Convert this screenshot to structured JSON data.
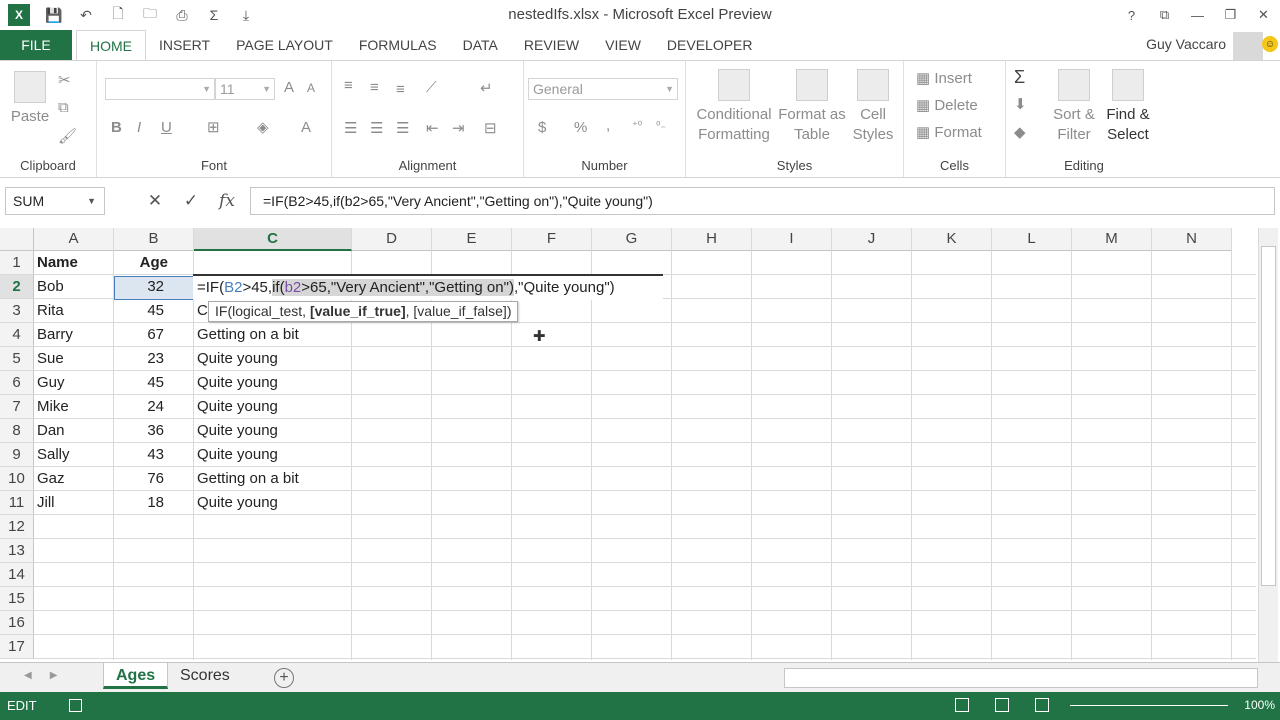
{
  "window": {
    "title": "nestedIfs.xlsx - Microsoft Excel Preview",
    "controls": [
      "?",
      "⧉",
      "—",
      "❐",
      "✕"
    ]
  },
  "qat": {
    "logo": "X",
    "icons": [
      "save-icon",
      "undo-icon",
      "new-icon",
      "open-icon",
      "print-preview-icon",
      "autosum-icon",
      "customize-icon"
    ]
  },
  "tabs": {
    "file": "FILE",
    "items": [
      "HOME",
      "INSERT",
      "PAGE LAYOUT",
      "FORMULAS",
      "DATA",
      "REVIEW",
      "VIEW",
      "DEVELOPER"
    ],
    "active": "HOME"
  },
  "user": {
    "name": "Guy Vaccaro"
  },
  "ribbon": {
    "clipboard": {
      "label": "Clipboard",
      "paste": "Paste"
    },
    "font": {
      "label": "Font",
      "size": "11",
      "bold": "B",
      "italic": "I",
      "underline": "U"
    },
    "alignment": {
      "label": "Alignment"
    },
    "number": {
      "label": "Number",
      "format": "General",
      "currency": "$",
      "percent": "%",
      "comma": ","
    },
    "styles": {
      "label": "Styles",
      "conditional_1": "Conditional",
      "conditional_2": "Formatting",
      "format_as_1": "Format as",
      "format_as_2": "Table",
      "cell_1": "Cell",
      "cell_2": "Styles"
    },
    "cells": {
      "label": "Cells",
      "insert": "Insert",
      "delete": "Delete",
      "format": "Format"
    },
    "editing": {
      "label": "Editing",
      "sort_1": "Sort &",
      "sort_2": "Filter",
      "find_1": "Find &",
      "find_2": "Select"
    }
  },
  "formula_bar": {
    "name_box": "SUM",
    "cancel": "✕",
    "enter": "✓",
    "fx": "fx",
    "formula": "=IF(B2>45,if(b2>65,\"Very Ancient\",\"Getting on\"),\"Quite young\")"
  },
  "columns": [
    "A",
    "B",
    "C",
    "D",
    "E",
    "F",
    "G",
    "H",
    "I",
    "J",
    "K",
    "L",
    "M",
    "N"
  ],
  "rows": [
    "1",
    "2",
    "3",
    "4",
    "5",
    "6",
    "7",
    "8",
    "9",
    "10",
    "11",
    "12",
    "13",
    "14",
    "15",
    "16",
    "17"
  ],
  "sheet": {
    "header": {
      "name": "Name",
      "age": "Age"
    },
    "data": [
      {
        "name": "Bob",
        "age": "32",
        "result": ""
      },
      {
        "name": "Rita",
        "age": "45",
        "result": "C"
      },
      {
        "name": "Barry",
        "age": "67",
        "result": "Getting on a bit"
      },
      {
        "name": "Sue",
        "age": "23",
        "result": "Quite young"
      },
      {
        "name": "Guy",
        "age": "45",
        "result": "Quite young"
      },
      {
        "name": "Mike",
        "age": "24",
        "result": "Quite young"
      },
      {
        "name": "Dan",
        "age": "36",
        "result": "Quite young"
      },
      {
        "name": "Sally",
        "age": "43",
        "result": "Quite young"
      },
      {
        "name": "Gaz",
        "age": "76",
        "result": "Getting on a bit"
      },
      {
        "name": "Jill",
        "age": "18",
        "result": "Quite young"
      }
    ]
  },
  "edit_cell": {
    "part1": "=IF(",
    "ref1": "B2",
    "part2": ">45,",
    "nested_if": "if(",
    "ref2": "b2",
    "nested_rest": ">65,\"Very Ancient\",\"Getting on\")",
    "part3": ",\"Quite young\")"
  },
  "tooltip": {
    "prefix": "IF(logical_test, ",
    "bold_arg": "[value_if_true]",
    "suffix": ", [value_if_false])"
  },
  "sheet_tabs": [
    "Ages",
    "Scores"
  ],
  "active_sheet": "Ages",
  "status": {
    "mode": "EDIT",
    "zoom": "100%"
  },
  "colors": {
    "excel_green": "#217346",
    "selection_blue": "#4a7ebb"
  }
}
